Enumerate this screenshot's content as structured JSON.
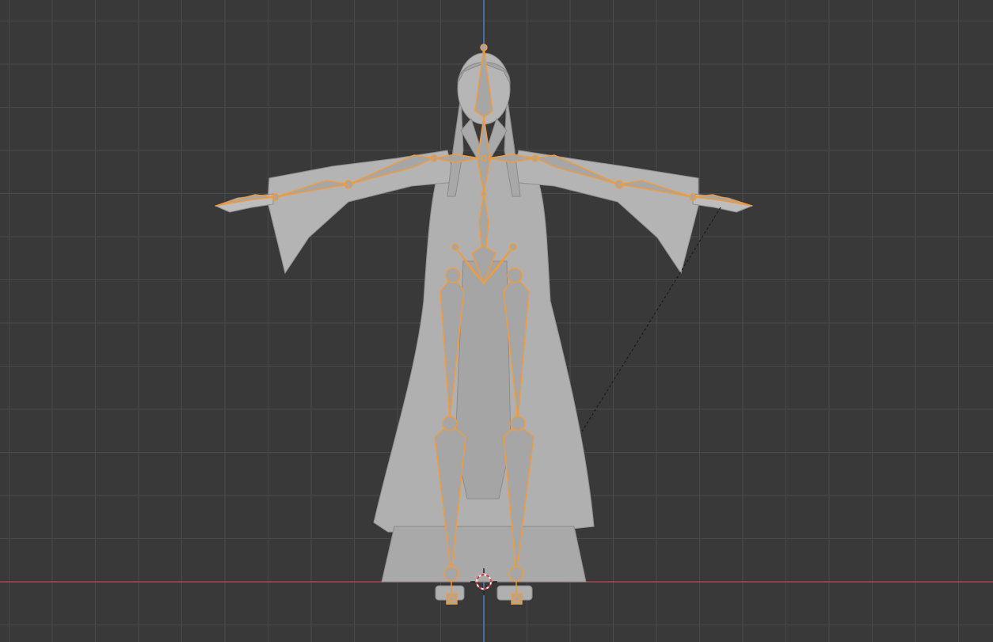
{
  "viewport": {
    "view": "front-orthographic",
    "mode": "pose",
    "background_color": "#393939",
    "grid_color": "#4a4a4a",
    "x_axis_color": "#b84a4f",
    "z_axis_color": "#4d7fc4"
  },
  "model": {
    "object": "robed-character-mesh",
    "shading": "solid",
    "body_color": "#b3b3b3",
    "shadow_color": "#8e8e8e"
  },
  "armature": {
    "selected": true,
    "outline_color": "#f39b3a",
    "bone_fill_color": "#a6a6a6",
    "bones": [
      "head",
      "neck",
      "chest",
      "spine",
      "hips",
      "shoulder-l",
      "shoulder-r",
      "upper-arm-l",
      "upper-arm-r",
      "forearm-l",
      "forearm-r",
      "hand-l",
      "hand-r",
      "pelvis-l",
      "pelvis-r",
      "thigh-l",
      "thigh-r",
      "shin-l",
      "shin-r",
      "foot-l",
      "foot-r"
    ],
    "ik_relation_line": "dashed"
  },
  "cursor_3d": {
    "colors": [
      "#e03a3a",
      "#f4f4f4"
    ]
  }
}
